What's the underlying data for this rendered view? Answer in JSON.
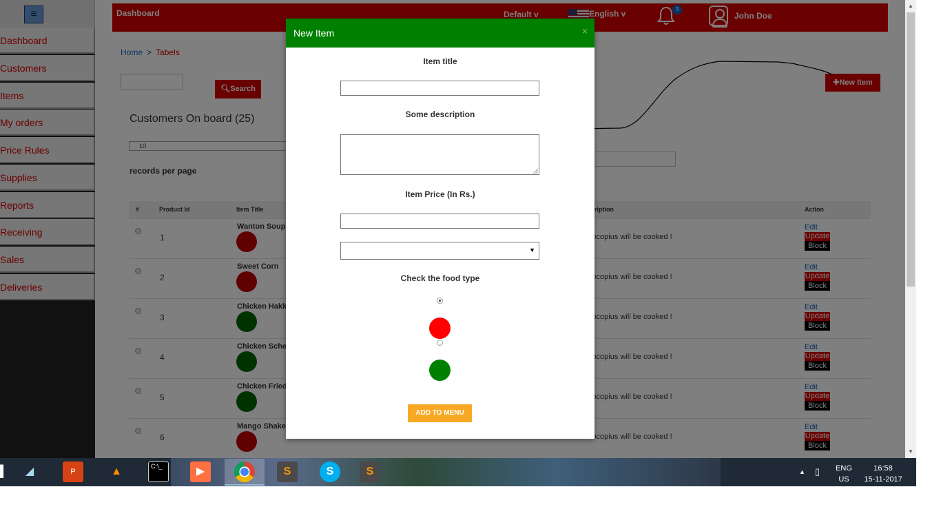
{
  "sidebar": {
    "menu_icon": "hamburger-icon",
    "items": [
      {
        "label": "Dashboard"
      },
      {
        "label": "Customers"
      },
      {
        "label": "Items"
      },
      {
        "label": "My orders"
      },
      {
        "label": "Price Rules"
      },
      {
        "label": "Supplies"
      },
      {
        "label": "Reports"
      },
      {
        "label": "Receiving"
      },
      {
        "label": "Sales"
      },
      {
        "label": "Deliveries"
      }
    ]
  },
  "header": {
    "brand": "Dashboard",
    "default_label": "Default v",
    "language_label": "English  v",
    "notification_count": "3",
    "user_name": "John Doe",
    "bar_color": "#d50000"
  },
  "breadcrumb": {
    "home": "Home",
    "separator": ">",
    "current": "Tabels"
  },
  "search": {
    "value": "",
    "button_label": "Search"
  },
  "toolbar": {
    "new_item_label": "New Item"
  },
  "list": {
    "title": "Customers On board (25)",
    "page_size": "10",
    "records_label": "records per page"
  },
  "table": {
    "columns": [
      "#",
      "Product Id",
      "Item Title",
      "Description",
      "Action"
    ],
    "visible_description_column_label": "ription",
    "rows": [
      {
        "id": "1",
        "title": "Wanton Soup",
        "type_color": "#c00000",
        "description": "locopius will be cooked !"
      },
      {
        "id": "2",
        "title": "Sweet Corn",
        "type_color": "#c00000",
        "description": "locopius will be cooked !"
      },
      {
        "id": "3",
        "title": "Chicken Hakka",
        "type_color": "#006400",
        "description": "locopius will be cooked !"
      },
      {
        "id": "4",
        "title": "Chicken Schez",
        "type_color": "#006400",
        "description": "locopius will be cooked !"
      },
      {
        "id": "5",
        "title": "Chicken Fried",
        "type_color": "#006400",
        "description": "locopius will be cooked !"
      },
      {
        "id": "6",
        "title": "Mango Shake",
        "type_color": "#c00000",
        "description": "locopius will be cooked !"
      }
    ],
    "actions": {
      "edit": "Edit",
      "update": "Update",
      "block": "Block"
    }
  },
  "modal": {
    "title": "New Item",
    "close_icon": "close-icon",
    "header_color": "#008000",
    "item_title_label": "Item title",
    "item_title_value": "",
    "description_label": "Some description",
    "description_value": "",
    "price_label": "Item Price (In Rs.)",
    "price_value": "",
    "select_value": "",
    "food_type_label": "Check the food type",
    "food_types": [
      {
        "color": "#ff0000",
        "checked": true
      },
      {
        "color": "#008000",
        "checked": false
      }
    ],
    "submit_label": "ADD TO MENU",
    "submit_color": "#f9a825"
  },
  "taskbar": {
    "apps": [
      "start-icon",
      "sticky-notes-icon",
      "powerpoint-icon",
      "vlc-icon",
      "cmd-icon",
      "media-player-icon",
      "chrome-icon",
      "sublime-text-icon",
      "skype-icon",
      "sublime-text-icon"
    ],
    "active_app": "chrome-icon",
    "lang_line1": "ENG",
    "lang_line2": "US",
    "time": "16:58",
    "date": "15-11-2017"
  }
}
